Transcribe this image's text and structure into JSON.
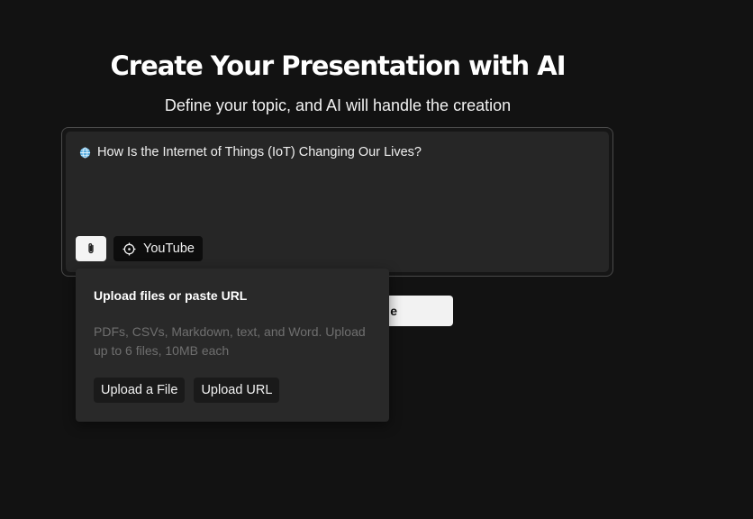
{
  "header": {
    "title": "Create Your Presentation with AI",
    "subtitle": "Define your topic, and AI will handle the creation"
  },
  "prompt": {
    "text": "How Is the Internet of Things (IoT) Changing Our Lives?",
    "leading_icon": "globe-icon"
  },
  "toolbar": {
    "attach_icon": "paperclip-icon",
    "youtube_icon": "crosshair-icon",
    "youtube_label": "YouTube"
  },
  "generate": {
    "visible_label": "e"
  },
  "upload_popover": {
    "title": "Upload files or paste URL",
    "description": "PDFs, CSVs, Markdown, text, and Word. Upload up to 6 files, 10MB each",
    "upload_file_label": "Upload a File",
    "upload_url_label": "Upload URL"
  },
  "colors": {
    "background": "#121212",
    "panel": "#262626",
    "popover": "#292929",
    "accent_light": "#f4f4f4",
    "muted_text": "#6f6f6f"
  }
}
